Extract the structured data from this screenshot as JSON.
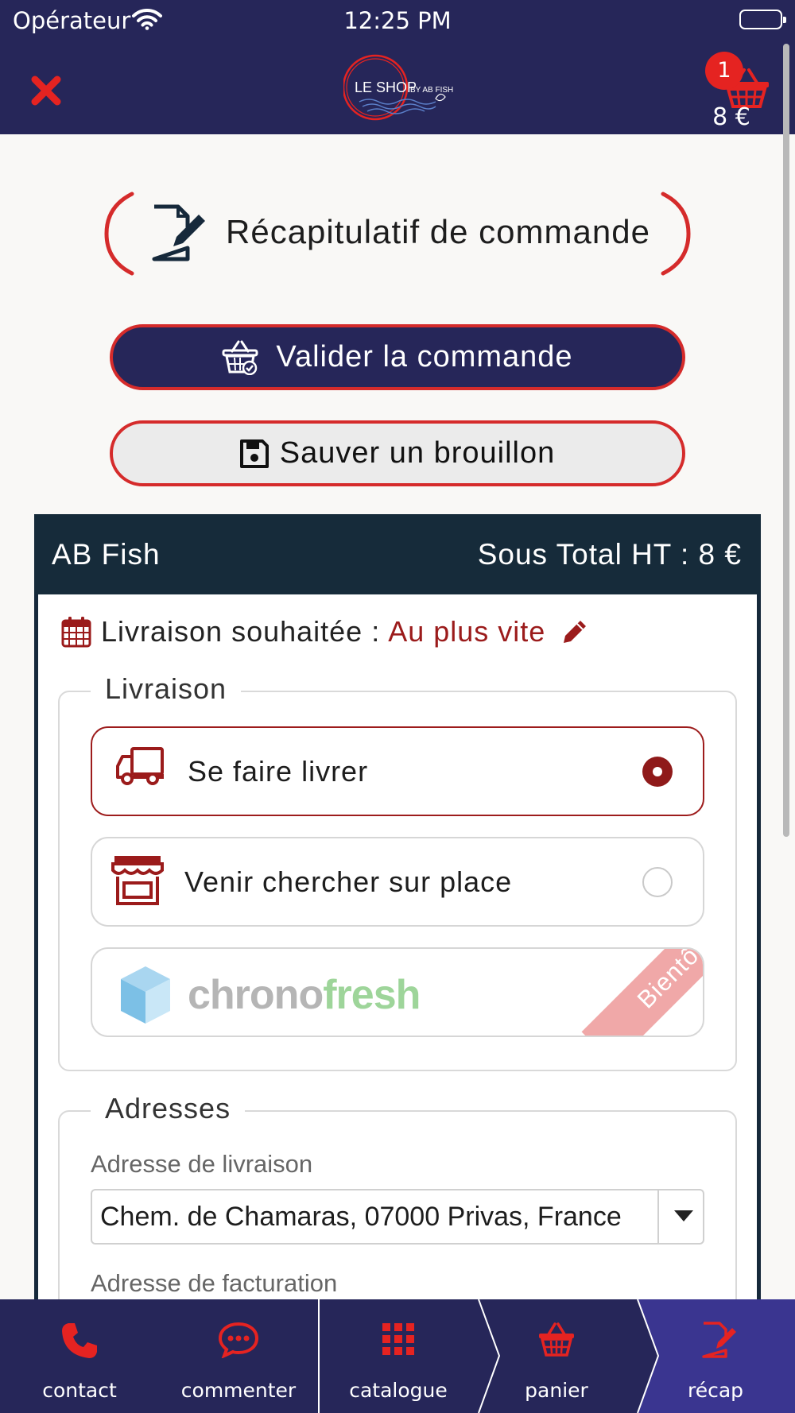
{
  "status_bar": {
    "carrier": "Opérateur",
    "time": "12:25 PM"
  },
  "header": {
    "close_icon": "close-x-icon",
    "logo_text_main": "LE SHOP",
    "logo_text_sub": "BY AB FISH",
    "cart_count": "1",
    "cart_total": "8 €"
  },
  "page": {
    "title": "Récapitulatif de commande"
  },
  "actions": {
    "validate_label": "Valider la commande",
    "draft_label": "Sauver un brouillon"
  },
  "order": {
    "shop_name": "AB Fish",
    "subtotal": "Sous Total HT : 8 €",
    "delivery_date_label": "Livraison souhaitée :",
    "delivery_date_value": "Au plus vite"
  },
  "delivery": {
    "legend": "Livraison",
    "options": [
      {
        "label": "Se faire livrer",
        "icon": "truck-icon",
        "selected": true
      },
      {
        "label": "Venir chercher sur place",
        "icon": "store-icon",
        "selected": false
      },
      {
        "label": "chronofresh",
        "icon": "chronofresh-logo",
        "badge": "Bientôt",
        "disabled": true
      }
    ]
  },
  "addresses": {
    "legend": "Adresses",
    "delivery_label": "Adresse de livraison",
    "delivery_value": "Chem. de Chamaras, 07000 Privas, France",
    "billing_label": "Adresse de facturation"
  },
  "tabs": [
    {
      "label": "contact",
      "icon": "phone-icon"
    },
    {
      "label": "commenter",
      "icon": "comment-icon"
    },
    {
      "label": "catalogue",
      "icon": "grid-icon"
    },
    {
      "label": "panier",
      "icon": "basket-icon"
    },
    {
      "label": "récap",
      "icon": "edit-document-icon",
      "active": true
    }
  ],
  "colors": {
    "navy": "#262659",
    "accent_red": "#e52321",
    "dark_teal": "#162b3a",
    "dark_red": "#9b1b1b"
  }
}
